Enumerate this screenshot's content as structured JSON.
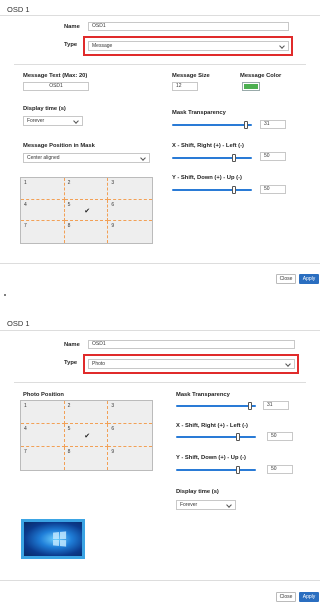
{
  "osd1": {
    "title": "OSD 1",
    "name_label": "Name",
    "name_value": "OSD1",
    "type_label": "Type",
    "type_value": "Message",
    "message_text_label": "Message Text (Max: 20)",
    "message_text_value": "OSD1",
    "message_size_label": "Message Size",
    "message_size_value": "12",
    "message_color_label": "Message Color",
    "message_color": "#4caf50",
    "display_time_label": "Display time (s)",
    "display_time_value": "Forever",
    "mask_transparency_label": "Mask Transparency",
    "mask_transparency_value": "31",
    "mask_transparency_level": 0.95,
    "position_label": "Message Position in Mask",
    "position_value": "Center aligned",
    "x_shift_label": "X - Shift, Right (+) - Left (-)",
    "x_shift_value": "50",
    "y_shift_label": "Y - Shift, Down (+) - Up (-)",
    "y_shift_value": "50",
    "grid_cells": [
      "1",
      "2",
      "3",
      "4",
      "5",
      "6",
      "7",
      "8",
      "9"
    ],
    "selected_cell": "5",
    "close_label": "Close",
    "apply_label": "Apply"
  },
  "osd2": {
    "title": "OSD 1",
    "name_label": "Name",
    "name_value": "OSD1",
    "type_label": "Type",
    "type_value": "Photo",
    "photo_position_label": "Photo Position",
    "mask_transparency_label": "Mask Transparency",
    "mask_transparency_value": "31",
    "mask_transparency_level": 0.95,
    "x_shift_label": "X - Shift, Right (+) - Left (-)",
    "x_shift_value": "50",
    "y_shift_label": "Y - Shift, Down (+) - Up (-)",
    "y_shift_value": "50",
    "display_time_label": "Display time (s)",
    "display_time_value": "Forever",
    "grid_cells": [
      "1",
      "2",
      "3",
      "4",
      "5",
      "6",
      "7",
      "8",
      "9"
    ],
    "selected_cell": "5",
    "close_label": "Close",
    "apply_label": "Apply"
  },
  "colors": {
    "accent": "#2a6ec0",
    "highlight": "#e02b2b",
    "grid_line": "#f2a056"
  },
  "icons": {
    "dropdown": "chevron-down-icon",
    "selected": "check-icon",
    "preview": "windows-wallpaper-image"
  }
}
